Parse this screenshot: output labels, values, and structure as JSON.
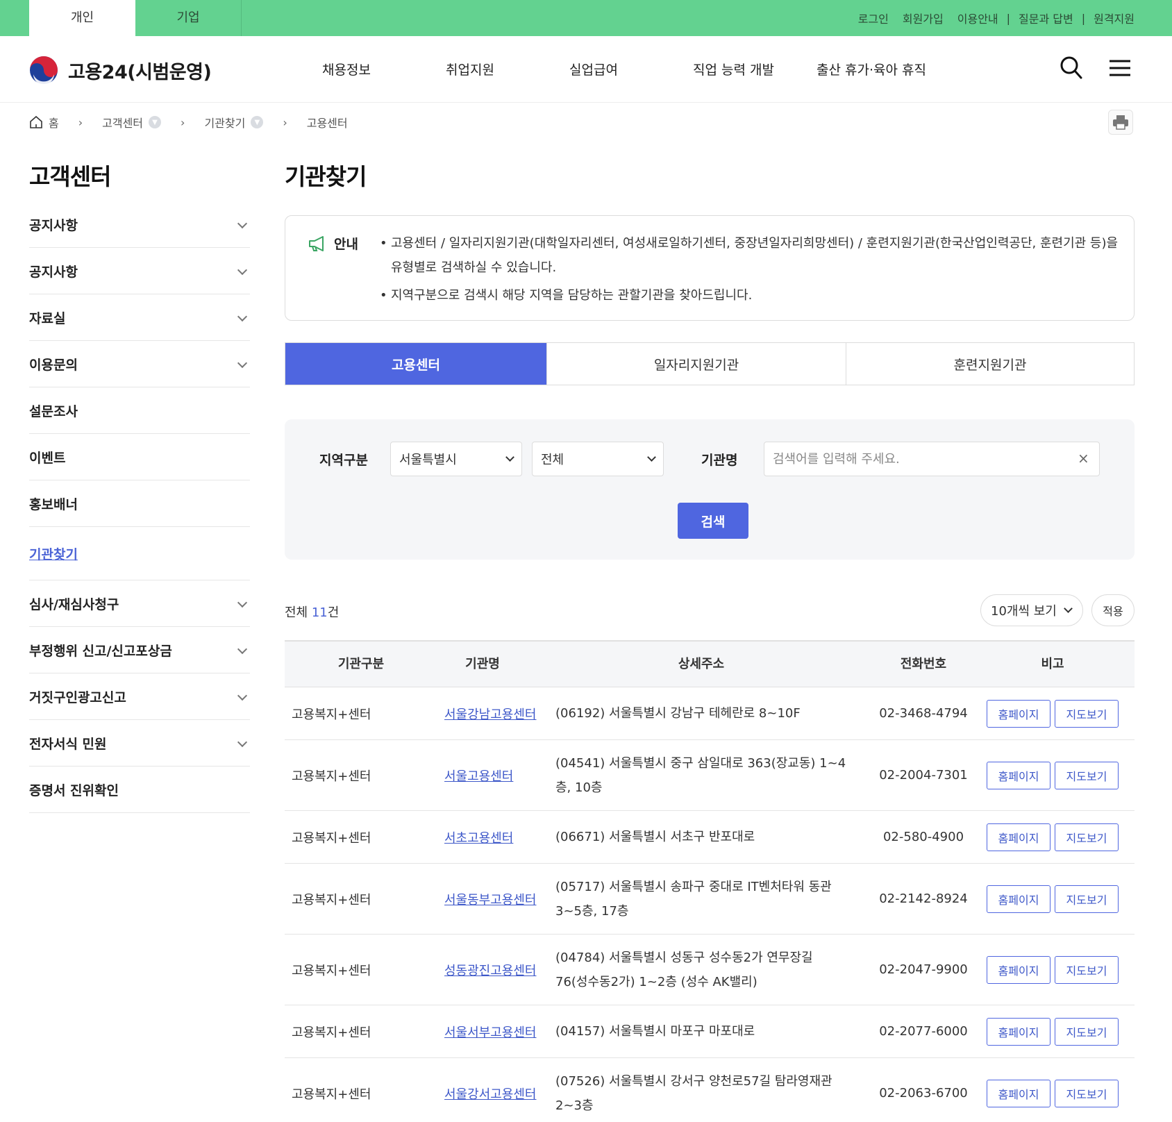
{
  "topbar": {
    "tabs": [
      "개인",
      "기업"
    ],
    "links": [
      "로그인",
      "회원가입",
      "이용안내",
      "질문과 답변",
      "원격지원"
    ]
  },
  "header": {
    "logo_text": "고용24(시범운영)",
    "nav": [
      "채용정보",
      "취업지원",
      "실업급여",
      "직업 능력 개발",
      "출산 휴가·육아 휴직"
    ]
  },
  "breadcrumb": [
    "홈",
    "고객센터",
    "기관찾기",
    "고용센터"
  ],
  "sidebar": {
    "title": "고객센터",
    "items": [
      "공지사항",
      "공지사항",
      "자료실",
      "이용문의",
      "설문조사",
      "이벤트",
      "홍보배너",
      "기관찾기",
      "심사/재심사청구",
      "부정행위 신고/신고포상금",
      "거짓구인광고신고",
      "전자서식 민원",
      "증명서 진위확인"
    ]
  },
  "main": {
    "title": "기관찾기",
    "guide_label": "안내",
    "guide_items": [
      "고용센터 / 일자리지원기관(대학일자리센터, 여성새로일하기센터, 중장년일자리희망센터) / 훈련지원기관(한국산업인력공단, 훈련기관 등)을 유형별로 검색하실 수 있습니다.",
      "지역구분으로 검색시 해당 지역을 담당하는 관할기관을 찾아드립니다."
    ],
    "tabs": [
      "고용센터",
      "일자리지원기관",
      "훈련지원기관"
    ]
  },
  "search": {
    "region_label": "지역구분",
    "region_value": "서울특별시",
    "district_value": "전체",
    "name_label": "기관명",
    "name_placeholder": "검색어를 입력해 주세요.",
    "clear": "×",
    "button": "검색"
  },
  "result": {
    "total_prefix": "전체",
    "total_count": "11",
    "total_suffix": "건",
    "perpage": "10개씩 보기",
    "apply": "적용"
  },
  "table": {
    "headers": [
      "기관구분",
      "기관명",
      "상세주소",
      "전화번호",
      "비고"
    ],
    "homepage_label": "홈페이지",
    "map_label": "지도보기",
    "rows": [
      {
        "type": "고용복지+센터",
        "name": "서울강남고용센터",
        "address": "(06192) 서울특별시 강남구 테헤란로 8~10F",
        "phone": "02-3468-4794"
      },
      {
        "type": "고용복지+센터",
        "name": "서울고용센터",
        "address": "(04541) 서울특별시 중구 삼일대로 363(장교동) 1~4층, 10층",
        "phone": "02-2004-7301"
      },
      {
        "type": "고용복지+센터",
        "name": "서초고용센터",
        "address": "(06671) 서울특별시 서초구 반포대로",
        "phone": "02-580-4900"
      },
      {
        "type": "고용복지+센터",
        "name": "서울동부고용센터",
        "address": "(05717) 서울특별시 송파구 중대로 IT벤처타워 동관 3~5층, 17층",
        "phone": "02-2142-8924"
      },
      {
        "type": "고용복지+센터",
        "name": "성동광진고용센터",
        "address": "(04784) 서울특별시 성동구 성수동2가 연무장길 76(성수동2가) 1~2층 (성수 AK밸리)",
        "phone": "02-2047-9900"
      },
      {
        "type": "고용복지+센터",
        "name": "서울서부고용센터",
        "address": "(04157) 서울특별시 마포구 마포대로",
        "phone": "02-2077-6000"
      },
      {
        "type": "고용복지+센터",
        "name": "서울강서고용센터",
        "address": "(07526) 서울특별시 강서구 양천로57길 탐라영재관 2~3층",
        "phone": "02-2063-6700"
      }
    ]
  },
  "colors": {
    "topbar_green": "#63d290",
    "accent_blue": "#4f66e0"
  }
}
